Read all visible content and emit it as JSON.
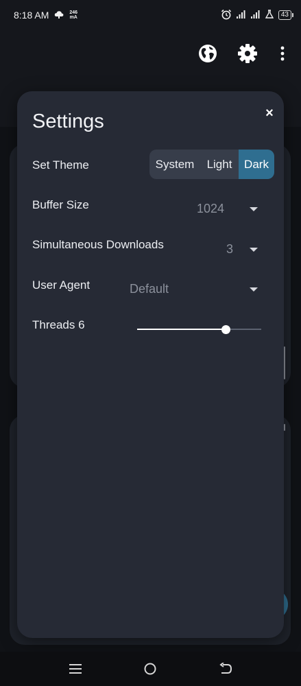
{
  "status_bar": {
    "time": "8:18 AM",
    "speed_value": "246",
    "speed_unit": "mA",
    "battery": "43"
  },
  "toolbar": {
    "icons": [
      "globe-icon",
      "gear-icon",
      "more-vert-icon"
    ]
  },
  "dialog": {
    "title": "Settings",
    "close_label": "×",
    "theme": {
      "label": "Set Theme",
      "options": [
        "System",
        "Light",
        "Dark"
      ],
      "selected": "Dark"
    },
    "buffer_size": {
      "label": "Buffer Size",
      "value": "1024"
    },
    "simultaneous_downloads": {
      "label": "Simultaneous Downloads",
      "value": "3"
    },
    "user_agent": {
      "label": "User Agent",
      "value": "Default"
    },
    "threads": {
      "label": "Threads 6",
      "value": 6,
      "fraction": 0.71
    }
  },
  "colors": {
    "accent": "#2f6e90",
    "dialog_bg": "#262a35",
    "segment_bg": "#373d4a"
  },
  "nav_bar": {
    "icons": [
      "menu-icon",
      "home-icon",
      "back-icon"
    ]
  }
}
